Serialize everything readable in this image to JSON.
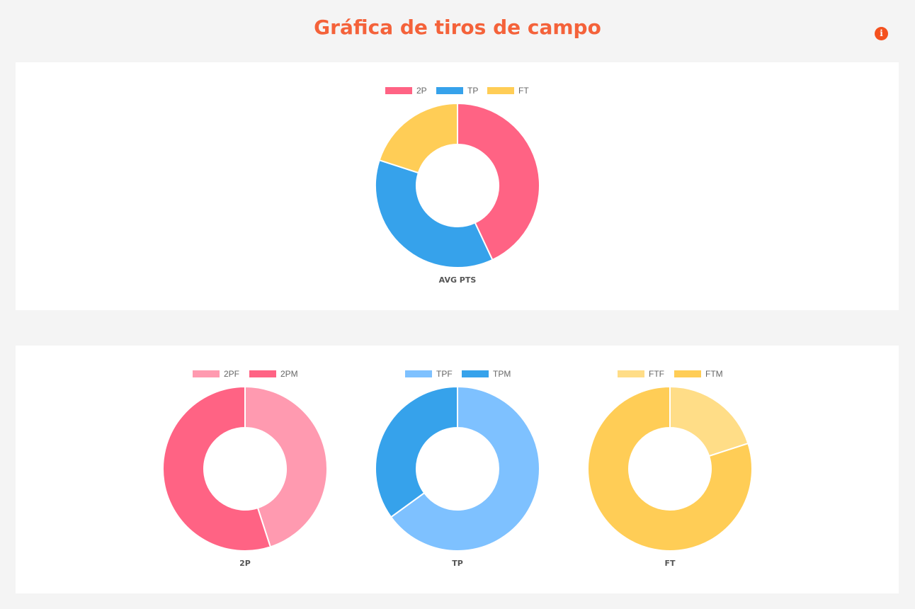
{
  "page": {
    "title": "Gráfica de tiros de campo",
    "info_icon": "info-icon",
    "info_glyph": "i"
  },
  "chart_data": [
    {
      "type": "donut",
      "label": "AVG PTS",
      "legend_placement": "top",
      "series": [
        {
          "name": "2P",
          "value": 43,
          "color": "#ff6384"
        },
        {
          "name": "TP",
          "value": 37,
          "color": "#36a2eb"
        },
        {
          "name": "FT",
          "value": 20,
          "color": "#ffcd56"
        }
      ]
    },
    {
      "type": "donut",
      "label": "2P",
      "legend_placement": "top",
      "series": [
        {
          "name": "2PF",
          "value": 45,
          "color": "#ff9ab0"
        },
        {
          "name": "2PM",
          "value": 55,
          "color": "#ff6384"
        }
      ]
    },
    {
      "type": "donut",
      "label": "TP",
      "legend_placement": "top",
      "series": [
        {
          "name": "TPF",
          "value": 65,
          "color": "#7ec1ff"
        },
        {
          "name": "TPM",
          "value": 35,
          "color": "#36a2eb"
        }
      ]
    },
    {
      "type": "donut",
      "label": "FT",
      "legend_placement": "top",
      "series": [
        {
          "name": "FTF",
          "value": 20,
          "color": "#ffdd87"
        },
        {
          "name": "FTM",
          "value": 80,
          "color": "#ffcd56"
        }
      ]
    }
  ]
}
